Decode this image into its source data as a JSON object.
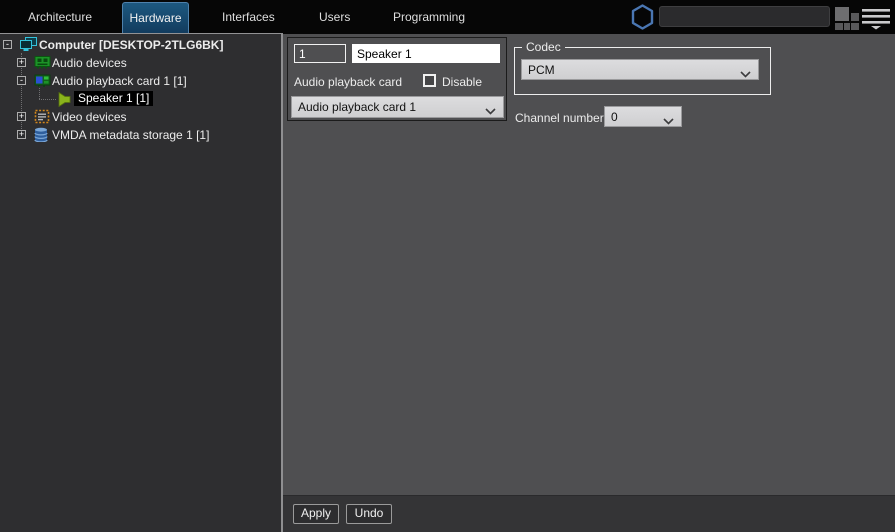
{
  "nav": {
    "tabs": [
      {
        "label": "Architecture",
        "active": false
      },
      {
        "label": "Hardware",
        "active": true
      },
      {
        "label": "Interfaces",
        "active": false
      },
      {
        "label": "Users",
        "active": false
      },
      {
        "label": "Programming",
        "active": false
      }
    ],
    "search": {
      "value": "",
      "placeholder": ""
    }
  },
  "tree": {
    "items": [
      {
        "label": "Computer [DESKTOP-2TLG6BK]",
        "expander": "-",
        "icon": "computer-icon",
        "level": 0,
        "selected": false
      },
      {
        "label": "Audio devices",
        "expander": "+",
        "icon": "audio-card-icon",
        "level": 1,
        "selected": false
      },
      {
        "label": "Audio playback card 1 [1]",
        "expander": "-",
        "icon": "playback-card-icon",
        "level": 1,
        "selected": false
      },
      {
        "label": "Speaker 1 [1]",
        "expander": "",
        "icon": "speaker-icon",
        "level": 2,
        "selected": true
      },
      {
        "label": "Video devices",
        "expander": "+",
        "icon": "video-devices-icon",
        "level": 1,
        "selected": false
      },
      {
        "label": "VMDA metadata storage 1 [1]",
        "expander": "+",
        "icon": "database-icon",
        "level": 1,
        "selected": false
      }
    ]
  },
  "form": {
    "id_value": "1",
    "name_value": "Speaker 1",
    "card_label": "Audio playback card",
    "disable_label": "Disable",
    "disable_checked": false,
    "card_value": "Audio playback card 1",
    "codec_legend": "Codec",
    "codec_value": "PCM",
    "channel_label": "Channel number",
    "channel_value": "0"
  },
  "footer": {
    "apply": "Apply",
    "undo": "Undo"
  },
  "colors": {
    "topbar_bg": "#060606",
    "active_tab_bg": "#17486b",
    "active_tab_border": "#4e81ac",
    "sidebar_bg": "#2e2e30",
    "panel_bg": "#4f4f51",
    "footer_bg": "#343436",
    "selection_bg": "#000000",
    "hexagon_blue": "#4a76b2",
    "dropdown_bg": "#d5d5d7"
  }
}
